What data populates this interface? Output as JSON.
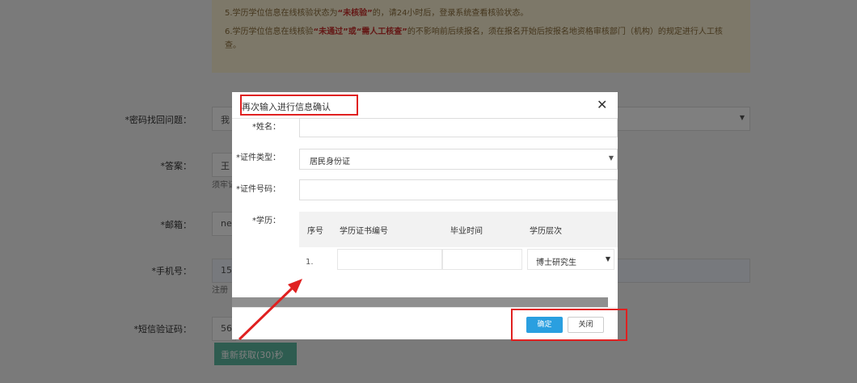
{
  "background": {
    "notice": {
      "line5": {
        "pre": "5.学历学位信息在线核验状态为",
        "highlight": "“未核验”",
        "post": "的，请24小时后，登录系统查看核验状态。"
      },
      "line6": {
        "pre": "6.学历学位信息在线核验",
        "highlight": "“未通过”或“需人工核查”",
        "post": "的不影响前后续报名，须在报名开始后按报名地资格审核部门（机构）的规定进行人工核查。"
      }
    },
    "labels": {
      "question": "*密码找回问题：",
      "answer": "*答案：",
      "email": "*邮箱：",
      "phone": "*手机号：",
      "sms": "*短信验证码："
    },
    "fields": {
      "question": "我",
      "answer": "王",
      "email": "ne",
      "phone": "15",
      "sms": "56"
    },
    "notes": {
      "answer": "须牢记",
      "phone": "注册"
    },
    "sms_button": "重新获取(30)秒"
  },
  "modal": {
    "title": "再次输入进行信息确认",
    "close_icon": "close-icon",
    "name_label": "*姓名：",
    "name_value": "",
    "id_type_label": "*证件类型：",
    "id_type_value": "居民身份证",
    "id_number_label": "*证件号码：",
    "id_number_value": "",
    "education_label": "*学历：",
    "table": {
      "headers": [
        "序号",
        "学历证书编号",
        "毕业时间",
        "学历层次"
      ],
      "rows": [
        {
          "index": "1.",
          "cert_no": "",
          "grad_time": "",
          "level": "博士研究生"
        }
      ]
    },
    "confirm_button": "确定",
    "close_button": "关闭"
  },
  "colors": {
    "accent": "#2a9fe0",
    "highlight": "#e02020",
    "sms_button": "#5cb8a0"
  }
}
